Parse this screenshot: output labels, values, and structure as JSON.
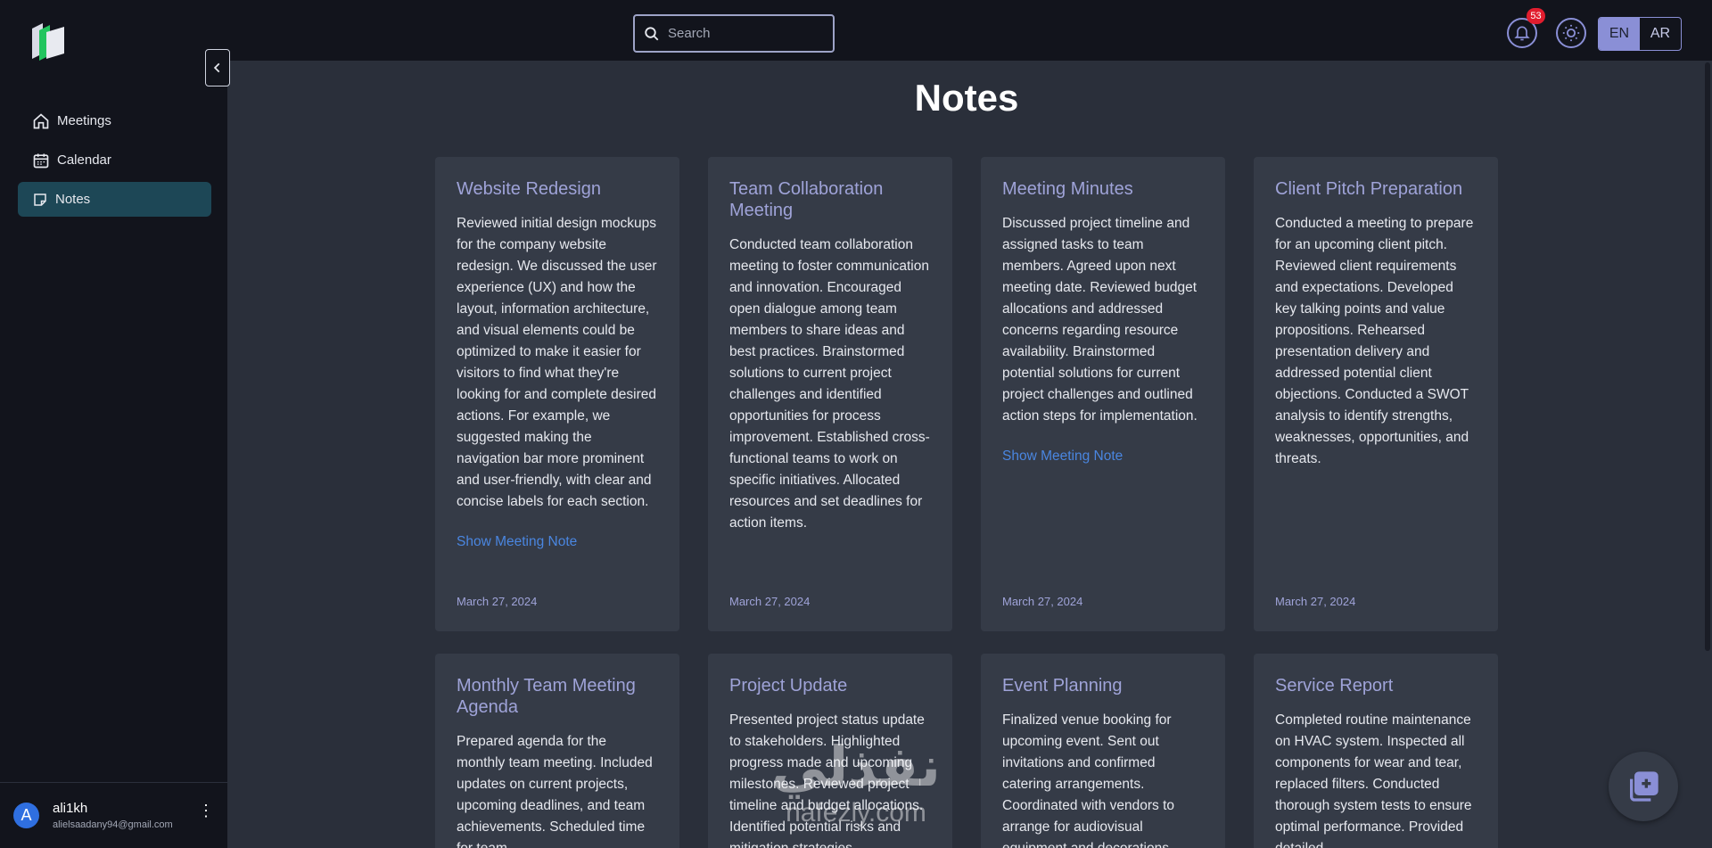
{
  "sidebar": {
    "items": [
      {
        "label": "Meetings"
      },
      {
        "label": "Calendar"
      },
      {
        "label": "Notes"
      }
    ],
    "user": {
      "avatar_letter": "A",
      "name": "ali1kh",
      "email": "alielsaadany94@gmail.com"
    }
  },
  "header": {
    "search_placeholder": "Search",
    "notification_count": "53",
    "lang": {
      "en": "EN",
      "ar": "AR"
    }
  },
  "main": {
    "title": "Notes",
    "notes": [
      {
        "title": "Website Redesign",
        "body": "Reviewed initial design mockups for the company website redesign. We discussed the user experience (UX) and how the layout, information architecture, and visual elements could be optimized to make it easier for visitors to find what they're looking for and complete desired actions. For example, we suggested making the navigation bar more prominent and user-friendly, with clear and concise labels for each section.",
        "link": "Show Meeting Note",
        "date": "March 27, 2024"
      },
      {
        "title": "Team Collaboration Meeting",
        "body": "Conducted team collaboration meeting to foster communication and innovation. Encouraged open dialogue among team members to share ideas and best practices. Brainstormed solutions to current project challenges and identified opportunities for process improvement. Established cross-functional teams to work on specific initiatives. Allocated resources and set deadlines for action items.",
        "date": "March 27, 2024"
      },
      {
        "title": "Meeting Minutes",
        "body": "Discussed project timeline and assigned tasks to team members. Agreed upon next meeting date. Reviewed budget allocations and addressed concerns regarding resource availability. Brainstormed potential solutions for current project challenges and outlined action steps for implementation.",
        "link": "Show Meeting Note",
        "date": "March 27, 2024"
      },
      {
        "title": "Client Pitch Preparation",
        "body": "Conducted a meeting to prepare for an upcoming client pitch. Reviewed client requirements and expectations. Developed key talking points and value propositions. Rehearsed presentation delivery and addressed potential client objections. Conducted a SWOT analysis to identify strengths, weaknesses, opportunities, and threats.",
        "date": "March 27, 2024"
      },
      {
        "title": "Monthly Team Meeting Agenda",
        "body": "Prepared agenda for the monthly team meeting. Included updates on current projects, upcoming deadlines, and team achievements. Scheduled time for team"
      },
      {
        "title": "Project Update",
        "body": "Presented project status update to stakeholders. Highlighted progress made and upcoming milestones. Reviewed project timeline and budget allocations. Identified potential risks and mitigation strategies."
      },
      {
        "title": "Event Planning",
        "body": "Finalized venue booking for upcoming event. Sent out invitations and confirmed catering arrangements. Coordinated with vendors to arrange for audiovisual equipment and decorations."
      },
      {
        "title": "Service Report",
        "body": "Completed routine maintenance on HVAC system. Inspected all components for wear and tear, replaced filters. Conducted thorough system tests to ensure optimal performance. Provided detailed"
      }
    ]
  },
  "watermark": {
    "arabic": "نفذلي",
    "latin": "nafezly.com"
  },
  "colors": {
    "accent": "#8a8fd6",
    "active_nav": "#1d4756",
    "link": "#4a86e0",
    "badge": "#e11d2e"
  }
}
